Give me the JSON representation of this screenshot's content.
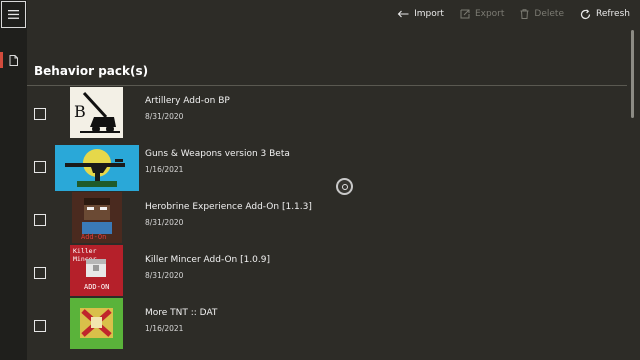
{
  "toolbar": {
    "import_label": "Import",
    "export_label": "Export",
    "delete_label": "Delete",
    "refresh_label": "Refresh"
  },
  "section": {
    "title": "Behavior pack(s)"
  },
  "packs": [
    {
      "name": "Artillery Add-on BP",
      "date": "8/31/2020",
      "icon": "artillery-pack-icon"
    },
    {
      "name": "Guns & Weapons version 3 Beta",
      "date": "1/16/2021",
      "icon": "guns-weapons-pack-icon"
    },
    {
      "name": "Herobrine Experience Add-On [1.1.3]",
      "date": "8/31/2020",
      "icon": "herobrine-pack-icon",
      "thumb_text": "Add-On"
    },
    {
      "name": "Killer Mincer Add-On [1.0.9]",
      "date": "8/31/2020",
      "icon": "killer-mincer-pack-icon",
      "thumb_title": "Killer Mincer",
      "thumb_text": "ADD-ON"
    },
    {
      "name": "More TNT :: DAT",
      "date": "1/16/2021",
      "icon": "more-tnt-pack-icon"
    }
  ],
  "colors": {
    "background": "#2d2c27",
    "rail": "#1f1f1c",
    "accent": "#d24b3c"
  }
}
